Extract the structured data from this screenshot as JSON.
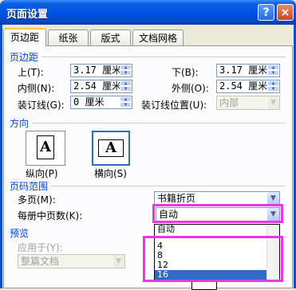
{
  "window": {
    "title": "页面设置",
    "help_label": "?",
    "close_label": "×"
  },
  "tabs": [
    "页边距",
    "纸张",
    "版式",
    "文档网格"
  ],
  "margins": {
    "section_label": "页边距",
    "top_label": "上(T):",
    "top_value": "3.17 厘米",
    "bottom_label": "下(B):",
    "bottom_value": "3.17 厘米",
    "inside_label": "内侧(N):",
    "inside_value": "2.54 厘米",
    "outside_label": "外侧(O):",
    "outside_value": "2.54 厘米",
    "gutter_label": "装订线(G):",
    "gutter_value": "0 厘米",
    "gutter_pos_label": "装订线位置(U):",
    "gutter_pos_value": "内部"
  },
  "orientation": {
    "section_label": "方向",
    "portrait_label": "纵向(P)",
    "landscape_label": "横向(S)",
    "icon_letter": "A"
  },
  "pages": {
    "section_label": "页码范围",
    "multiple_label": "多页(M):",
    "multiple_value": "书籍折页",
    "sheets_label": "每册中页数(K):",
    "sheets_value": "自动"
  },
  "preview": {
    "section_label": "预览",
    "apply_label": "应用于(Y):",
    "apply_value": "整篇文档"
  },
  "dropdown_items": [
    "自动",
    "4",
    "8",
    "12",
    "16"
  ],
  "dropdown_selected": "16",
  "colors": {
    "highlight": "#E23BE3",
    "title_bar": "#0054E3",
    "selection": "#316AC5"
  }
}
